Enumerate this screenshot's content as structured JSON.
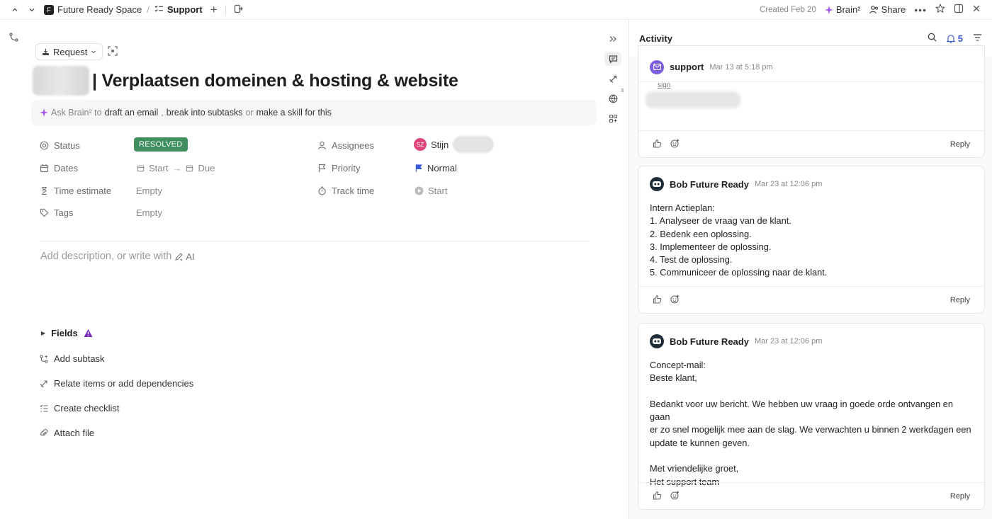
{
  "topbar": {
    "space": "Future Ready Space",
    "separator": "/",
    "list": "Support",
    "created": "Created Feb 20",
    "brain": "Brain²",
    "share": "Share"
  },
  "task": {
    "type_button": "Request",
    "title": "| Verplaatsen domeinen & hosting & website",
    "brain_prompt": {
      "prefix": "Ask Brain² to",
      "opt1": "draft an email",
      "sep1": ",",
      "opt2": "break into subtasks",
      "or": "or",
      "opt3": "make a skill for this"
    }
  },
  "properties": {
    "status_label": "Status",
    "status_value": "RESOLVED",
    "dates_label": "Dates",
    "start": "Start",
    "due": "Due",
    "time_estimate_label": "Time estimate",
    "time_estimate_value": "Empty",
    "tags_label": "Tags",
    "tags_value": "Empty",
    "assignees_label": "Assignees",
    "assignee_initials": "SZ",
    "assignee_name": "Stijn",
    "priority_label": "Priority",
    "priority_value": "Normal",
    "track_time_label": "Track time",
    "track_time_value": "Start"
  },
  "description": {
    "placeholder": "Add description, or write with",
    "ai": "AI"
  },
  "sections": {
    "fields": "Fields",
    "add_subtask": "Add subtask",
    "relate": "Relate items or add dependencies",
    "checklist": "Create checklist",
    "attach": "Attach file"
  },
  "activity": {
    "title": "Activity",
    "notification_count": "5",
    "reply_label": "Reply",
    "comments": [
      {
        "author": "support",
        "time": "Mar 13 at 5:18 pm",
        "sign": "sign"
      },
      {
        "author": "Bob Future Ready",
        "time": "Mar 23 at 12:06 pm",
        "lines": [
          "Intern Actieplan:",
          "1. Analyseer de vraag van de klant.",
          "2. Bedenk een oplossing.",
          "3. Implementeer de oplossing.",
          "4. Test de oplossing.",
          "5. Communiceer de oplossing naar de klant."
        ]
      },
      {
        "author": "Bob Future Ready",
        "time": "Mar 23 at 12:06 pm",
        "lines": [
          "Concept-mail:",
          "Beste klant,",
          "",
          "Bedankt voor uw bericht. We hebben uw vraag in goede orde ontvangen en gaan",
          "er zo snel mogelijk mee aan de slag. We verwachten u binnen 2 werkdagen een",
          "update te kunnen geven.",
          "",
          "Met vriendelijke groet,",
          "Het support team"
        ]
      }
    ]
  },
  "colors": {
    "resolved": "#3f8f5e",
    "accent": "#3b5bdb",
    "avatar_sz": "#e0457a",
    "priority_flag": "#3b5bdb",
    "fields_warning": "#7b2fbf"
  }
}
